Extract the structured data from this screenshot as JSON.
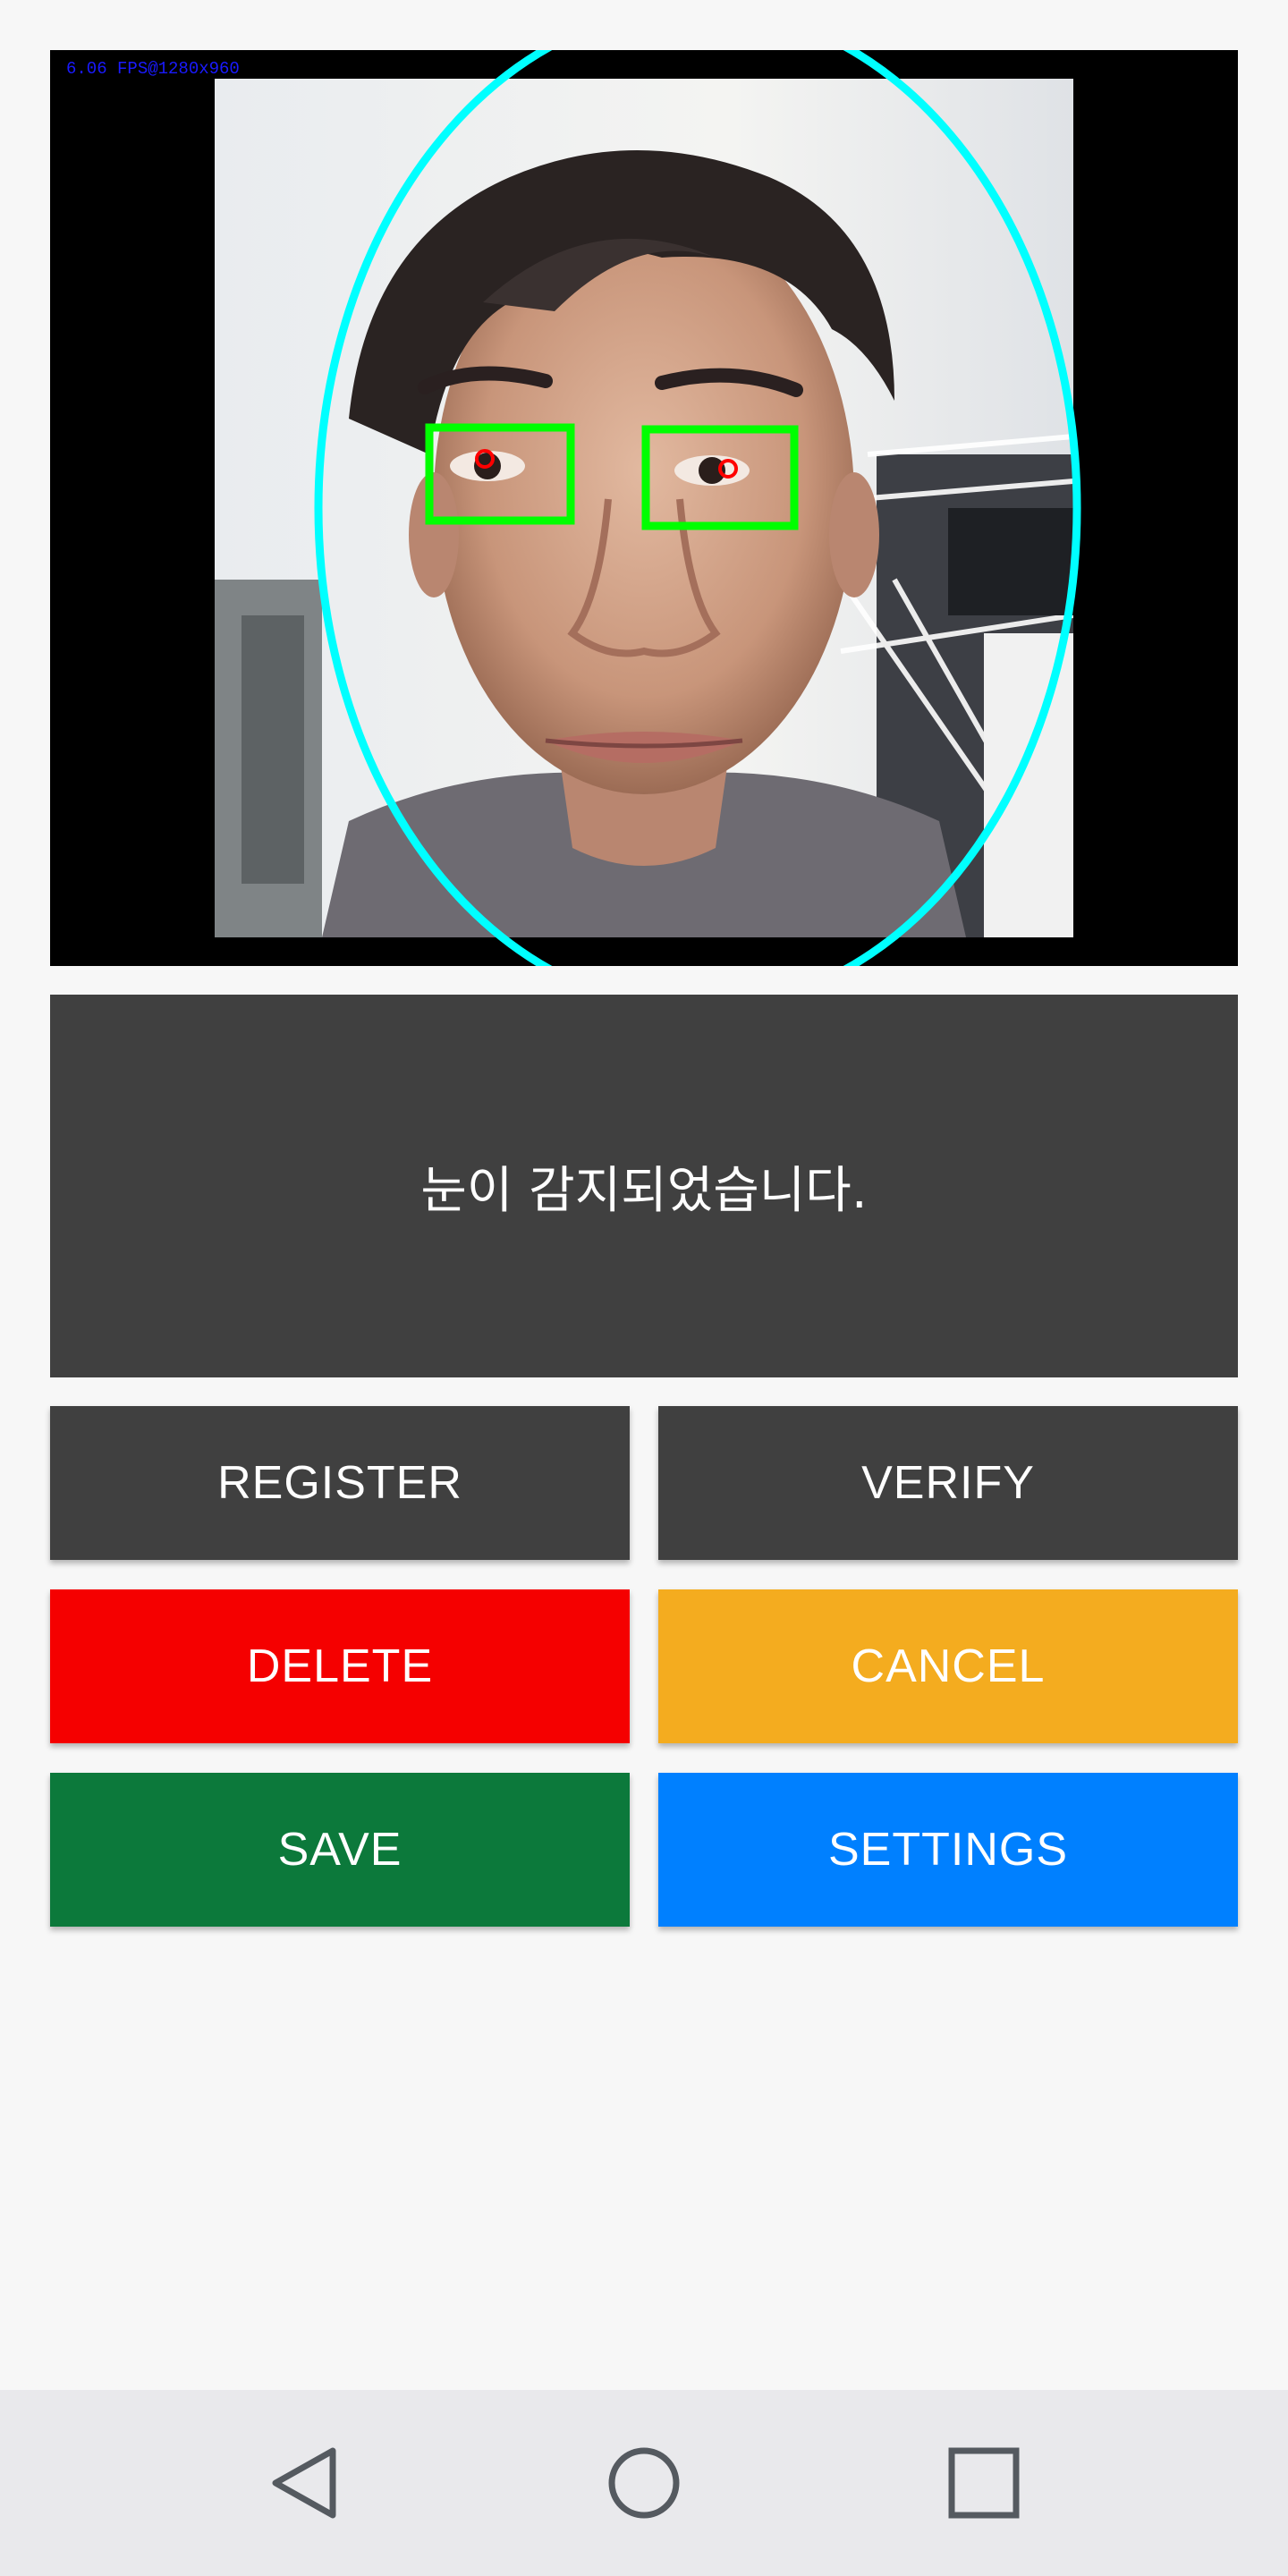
{
  "camera": {
    "fps_label": "6.06 FPS@1280x960"
  },
  "status": {
    "message": "눈이 감지되었습니다."
  },
  "buttons": {
    "register": "REGISTER",
    "verify": "VERIFY",
    "delete": "DELETE",
    "cancel": "CANCEL",
    "save": "SAVE",
    "settings": "SETTINGS"
  },
  "colors": {
    "register": "#404040",
    "verify": "#404040",
    "delete": "#f50000",
    "cancel": "#f4ac1f",
    "save": "#0c793b",
    "settings": "#0080ff",
    "face_oval": "#00ffff",
    "eye_box": "#00ff00",
    "pupil_marker": "#ff0000"
  },
  "navigation": {
    "back_icon": "triangle-back-icon",
    "home_icon": "circle-home-icon",
    "recents_icon": "square-recents-icon"
  }
}
